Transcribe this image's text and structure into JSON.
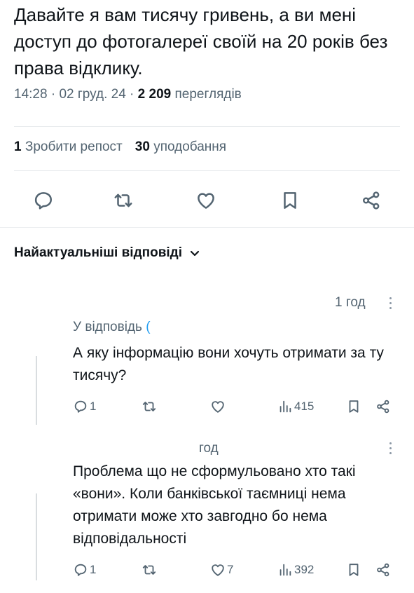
{
  "post": {
    "text": "Давайте я вам тисячу гривень, а ви мені доступ до фотогалереї своїй на 20 років без права відклику.",
    "time": "14:28",
    "date": "02 груд. 24",
    "views_count": "2 209",
    "views_label": "переглядів",
    "reposts_count": "1",
    "reposts_label": "Зробити репост",
    "likes_count": "30",
    "likes_label": "уподобання"
  },
  "icons": [
    "reply-icon",
    "repost-icon",
    "like-icon",
    "bookmark-icon",
    "share-icon",
    "chevron-down-icon",
    "views-icon",
    "more-icon"
  ],
  "colors": {
    "text": "#0f1419",
    "secondary": "#536471",
    "link": "#1d9bf0"
  },
  "replies_header": {
    "sort_label": "Найактуальніші відповіді"
  },
  "replies": [
    {
      "time": "1 год",
      "replying_to": "У відповідь",
      "mention": "(",
      "text": "А яку інформацію вони хочуть отримати за ту тисячу?",
      "reply_count": "1",
      "like_count": "",
      "views": "415"
    },
    {
      "time": "год",
      "text": "Проблема що не сформульовано хто такі «вони». Коли банківської таємниці нема отримати може хто завгодно бо нема відповідальності",
      "reply_count": "1",
      "like_count": "7",
      "views": "392"
    }
  ]
}
